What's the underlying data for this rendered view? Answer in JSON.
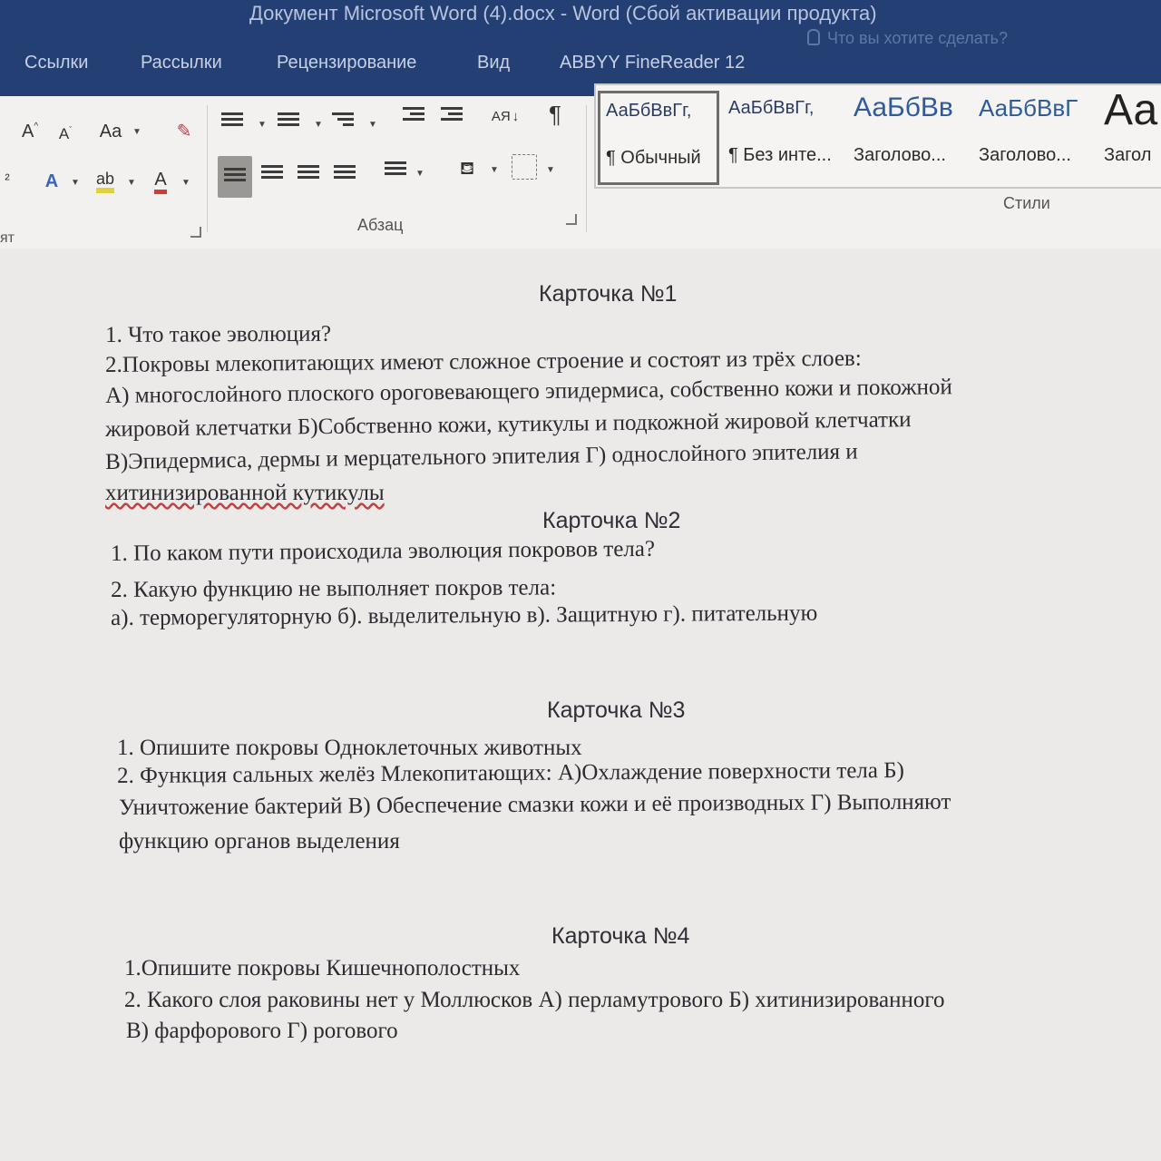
{
  "window": {
    "title": "Документ Microsoft Word (4).docx  -  Word (Сбой активации продукта)"
  },
  "ribbon_tabs": [
    "Ссылки",
    "Рассылки",
    "Рецензирование",
    "Вид",
    "ABBYY FineReader 12"
  ],
  "tell_me": "Что вы хотите сделать?",
  "font_group": {
    "grow": "A",
    "shrink": "A",
    "case": "Aa",
    "effects": "A",
    "highlight": "ab",
    "color": "A",
    "label": "ят"
  },
  "paragraph_group": {
    "label": "Абзац",
    "sort": "АЯ",
    "pilcrow": "¶"
  },
  "styles_group": {
    "label": "Стили",
    "items": [
      {
        "sample": "АаБбВвГг,",
        "name": "¶ Обычный",
        "selected": true
      },
      {
        "sample": "АаБбВвГг,",
        "name": "¶ Без инте..."
      },
      {
        "sample": "АаБбВв",
        "name": "Заголово..."
      },
      {
        "sample": "АаБбВвГ",
        "name": "Заголово..."
      },
      {
        "sample": "Аа",
        "name": "Загол"
      }
    ]
  },
  "document": {
    "cards": [
      {
        "title": "Карточка №1",
        "lines": [
          "1. Что такое эволюция?",
          "2.Покровы млекопитающих имеют сложное строение и состоят из трёх слоев:",
          "А) многослойного плоского ороговевающего эпидермиса, собственно кожи и покожной",
          "жировой клетчатки Б)Собственно кожи, кутикулы и подкожной жировой клетчатки",
          "В)Эпидермиса, дермы и мерцательного эпителия Г) однослойного эпителия и",
          "хитинизированной кутикулы"
        ]
      },
      {
        "title": "Карточка №2",
        "lines": [
          "1. По каком пути происходила эволюция покровов тела?",
          "2. Какую функцию не выполняет покров тела:",
          "а). терморегуляторную б). выделительную в). Защитную г). питательную"
        ]
      },
      {
        "title": "Карточка №3",
        "lines": [
          "1. Опишите покровы Одноклеточных животных",
          "2. Функция сальных желёз Млекопитающих: А)Охлаждение поверхности тела Б)",
          "Уничтожение бактерий В) Обеспечение смазки кожи и её производных Г) Выполняют",
          "функцию органов выделения"
        ]
      },
      {
        "title": "Карточка №4",
        "lines": [
          "1.Опишите покровы Кишечнополостных",
          "2. Какого слоя раковины нет у Моллюсков А) перламутрового Б) хитинизированного",
          "В) фарфорового Г) рогового"
        ]
      }
    ]
  }
}
